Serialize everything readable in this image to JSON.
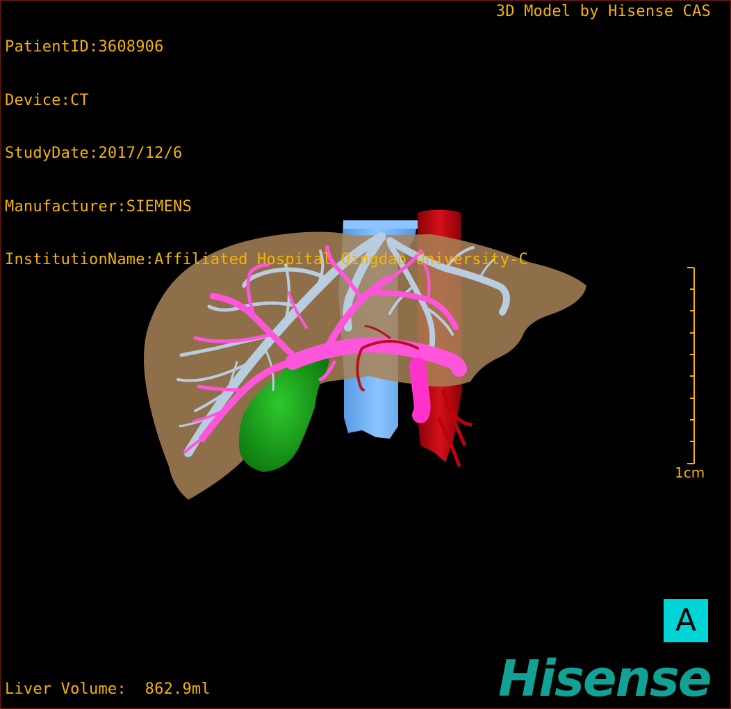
{
  "patient": {
    "lines": [
      "PatientID:3608906",
      "Device:CT",
      "StudyDate:2017/12/6",
      "Manufacturer:SIEMENS",
      "InstitutionName:Affiliated Hospital Qingdao University-C"
    ]
  },
  "credit": "3D Model by Hisense CAS",
  "scale": {
    "label": "1cm"
  },
  "orientation": {
    "label": "A"
  },
  "volume": {
    "text": "Liver Volume:  862.9ml"
  },
  "logo": {
    "text": "Hisense"
  },
  "colors": {
    "info_text": "#f5b400",
    "liver": "#a88256",
    "hepatic_vein": "#b8cde0",
    "portal_vein": "#ff55dd",
    "vena_cava": "#6aaef0",
    "aorta": "#b00008",
    "gallbladder": "#18a018",
    "orientation_bg": "#00d4d4",
    "logo": "#12a295"
  }
}
